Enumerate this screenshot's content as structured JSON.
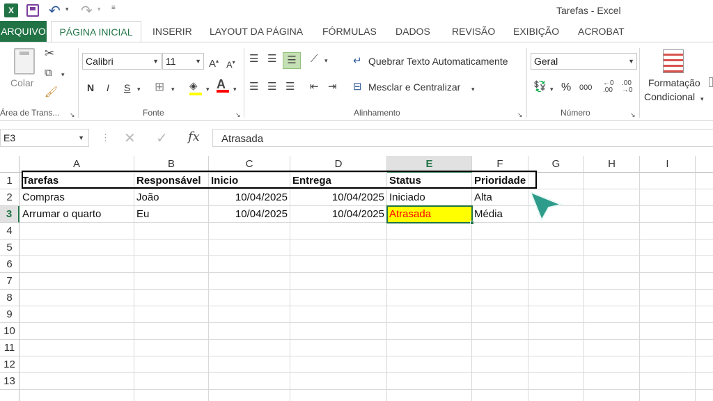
{
  "window": {
    "title": "Tarefas - Excel"
  },
  "quick_access": {
    "icons": [
      "excel-logo-icon",
      "save-icon",
      "undo-icon",
      "redo-icon",
      "customize-icon"
    ]
  },
  "tabs": [
    "ARQUIVO",
    "PÁGINA INICIAL",
    "INSERIR",
    "LAYOUT DA PÁGINA",
    "FÓRMULAS",
    "DADOS",
    "REVISÃO",
    "EXIBIÇÃO",
    "ACROBAT"
  ],
  "active_tab": "PÁGINA INICIAL",
  "colors": {
    "file_tab": "#217346",
    "accent": "#217346",
    "highlight_fill": "#ffff00",
    "highlight_text": "#ff0000",
    "cursor": "#2e9c8a"
  },
  "ribbon": {
    "clipboard": {
      "paste_label": "Colar",
      "group_label": "Área de Trans..."
    },
    "font": {
      "font_name": "Calibri",
      "font_size": "11",
      "bold": "N",
      "italic": "I",
      "underline": "S",
      "group_label": "Fonte"
    },
    "alignment": {
      "wrap_text": "Quebrar Texto Automaticamente",
      "merge_center": "Mesclar e Centralizar",
      "group_label": "Alinhamento"
    },
    "number": {
      "format": "Geral",
      "percent": "%",
      "thousands": "000",
      "group_label": "Número"
    },
    "styles": {
      "conditional_line1": "Formatação",
      "conditional_line2": "Condicional"
    }
  },
  "formula_bar": {
    "name_box": "E3",
    "fx": "fx",
    "content": "Atrasada"
  },
  "sheet": {
    "columns": [
      "A",
      "B",
      "C",
      "D",
      "E",
      "F",
      "G",
      "H",
      "I"
    ],
    "active_column": "E",
    "active_row": "3",
    "rows": [
      "1",
      "2",
      "3",
      "4",
      "5",
      "6",
      "7",
      "8",
      "9",
      "10",
      "11",
      "12",
      "13"
    ],
    "data": [
      [
        "Tarefas",
        "Responsável",
        "Inicio",
        "Entrega",
        "Status",
        "Prioridade"
      ],
      [
        "Compras",
        "João",
        "10/04/2025",
        "10/04/2025",
        "Iniciado",
        "Alta"
      ],
      [
        "Arrumar o quarto",
        "Eu",
        "10/04/2025",
        "10/04/2025",
        "Atrasada",
        "Média"
      ]
    ]
  }
}
